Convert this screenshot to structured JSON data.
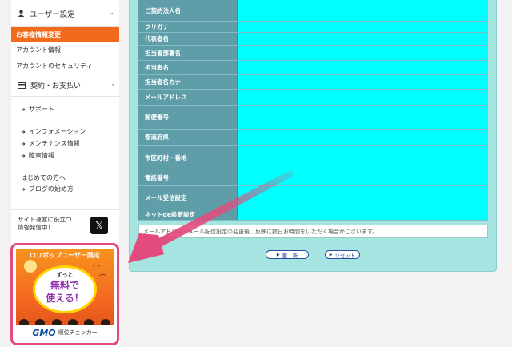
{
  "sidebar": {
    "user_settings": "ユーザー設定",
    "active_item": "お客様情報変更",
    "items": [
      "アカウント情報",
      "アカウントのセキュリティ"
    ],
    "payment": "契約・お支払い",
    "support": "サポート",
    "info_links": [
      "インフォメーション",
      "メンテナンス情報",
      "障害情報"
    ],
    "beginner": "はじめての方へ",
    "blog_start": "ブログの始め方",
    "tweet_text_1": "サイト運営に役立つ",
    "tweet_text_2": "情報発信中！",
    "x_logo": "𝕏"
  },
  "banner": {
    "title": "ロリポップユーザー限定",
    "burst_small": "ずっと",
    "burst_main_1": "無料で",
    "burst_main_2": "使える！",
    "gmo_logo": "GMO",
    "gmo_text": "順位チェッカー"
  },
  "form": {
    "rows": [
      {
        "label": "ご契約法人名"
      },
      {
        "label": "フリガナ"
      },
      {
        "label": "代表者名"
      },
      {
        "label": "担当者部署名"
      },
      {
        "label": "担当者名"
      },
      {
        "label": "担当者名カナ"
      },
      {
        "label": "メールアドレス"
      },
      {
        "label": "郵便番号"
      },
      {
        "label": "都道府県"
      },
      {
        "label": "市区町村・番地"
      },
      {
        "label": "電話番号"
      },
      {
        "label": "メール受信設定"
      },
      {
        "label": "ネットde診断設定"
      }
    ],
    "note": "メールアドレス・メール配信設定の変更後、反映に数日お時間をいただく場合がございます。",
    "update_button": "更　新",
    "reset_button": "リセット"
  },
  "colors": {
    "accent": "#f26b1c",
    "label_bg": "#5f9ea8",
    "input_bg": "#00ffff",
    "panel_bg": "#a6e4e1",
    "arrow": "#e34a7e"
  },
  "icons": {
    "user": "user-icon",
    "card": "card-icon",
    "chevron": "chevron-right-icon"
  }
}
